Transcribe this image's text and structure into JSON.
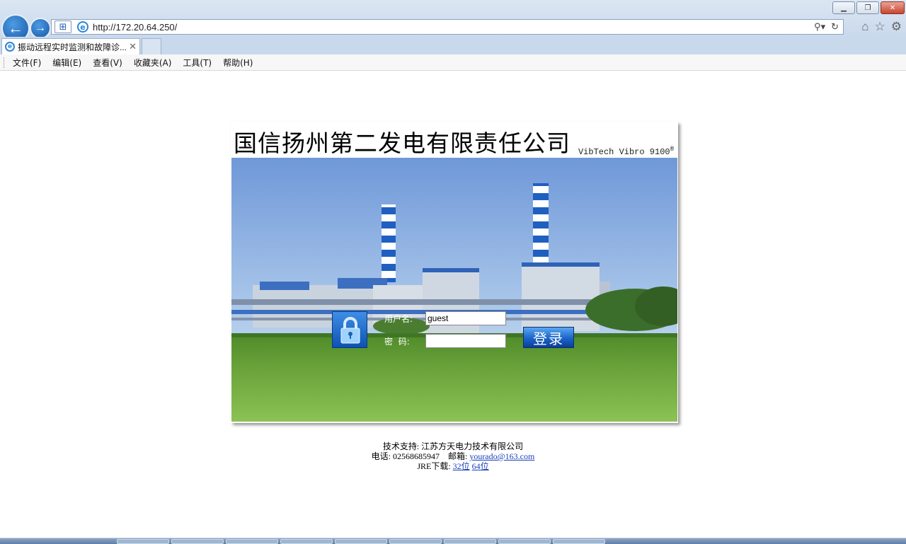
{
  "browser": {
    "url": "http://172.20.64.250/",
    "tab_title": "振动远程实时监测和故障诊...",
    "menu": [
      "文件(F)",
      "编辑(E)",
      "查看(V)",
      "收藏夹(A)",
      "工具(T)",
      "帮助(H)"
    ]
  },
  "page": {
    "company_title": "国信扬州第二发电有限责任公司",
    "product_name": "VibTech Vibro 9100",
    "product_mark": "®",
    "login": {
      "username_label": "用户名:",
      "username_value": "guest",
      "password_label": "密  码:",
      "password_value": "",
      "login_button": "登录"
    },
    "footer": {
      "support": "技术支持: 江苏方天电力技术有限公司",
      "phone_prefix": "电话: 02568685947    邮箱: ",
      "email": "yourado@163.com",
      "jre_prefix": "JRE下载: ",
      "jre_32": "32位",
      "jre_64": "64位"
    }
  }
}
